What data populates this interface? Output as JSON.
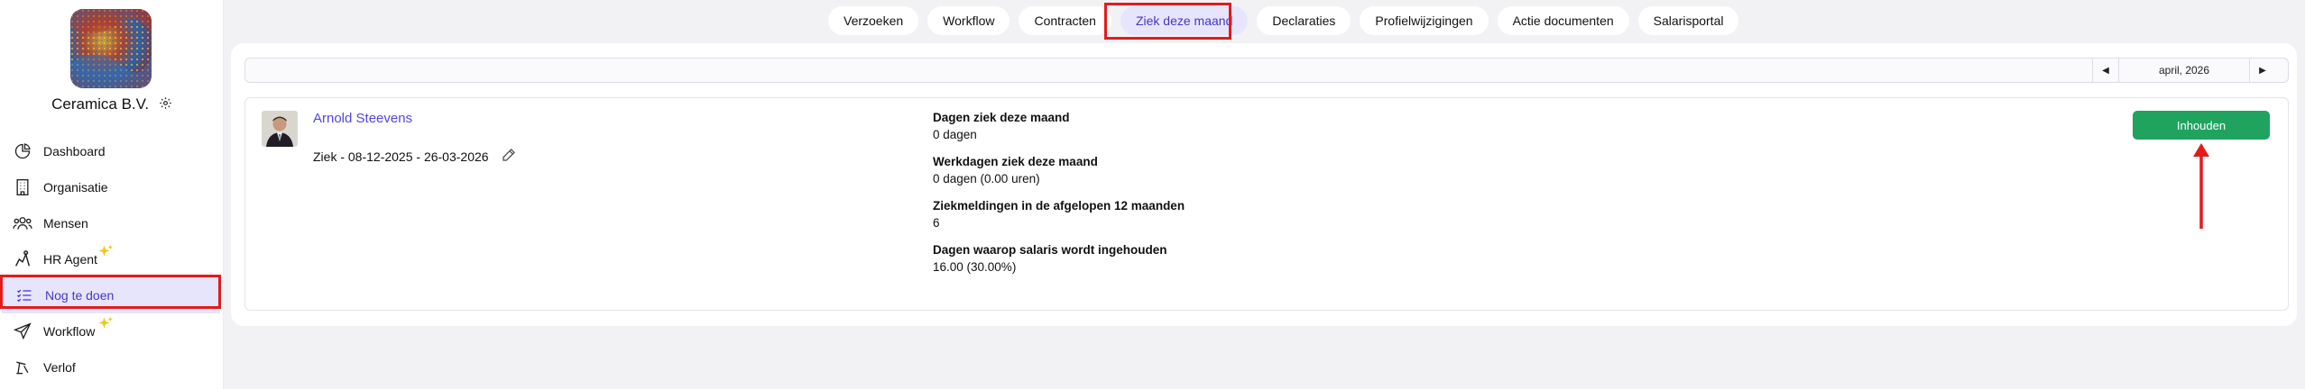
{
  "sidebar": {
    "company_name": "Ceramica B.V.",
    "items": [
      {
        "label": "Dashboard",
        "icon": "dashboard-icon"
      },
      {
        "label": "Organisatie",
        "icon": "building-icon"
      },
      {
        "label": "Mensen",
        "icon": "people-icon"
      },
      {
        "label": "HR Agent",
        "icon": "agent-icon",
        "badge": "sparkle-icon"
      },
      {
        "label": "Nog te doen",
        "icon": "checklist-icon",
        "active": true
      },
      {
        "label": "Workflow",
        "icon": "send-icon",
        "badge": "sparkle-icon"
      },
      {
        "label": "Verlof",
        "icon": "umbrella-icon"
      }
    ]
  },
  "tabs": [
    {
      "label": "Verzoeken"
    },
    {
      "label": "Workflow"
    },
    {
      "label": "Contracten"
    },
    {
      "label": "Ziek deze maand",
      "active": true
    },
    {
      "label": "Declaraties"
    },
    {
      "label": "Profielwijzigingen"
    },
    {
      "label": "Actie documenten"
    },
    {
      "label": "Salarisportal"
    }
  ],
  "date_filter": {
    "current": "april, 2026",
    "prev_icon": "chevron-left-icon",
    "next_icon": "chevron-right-icon"
  },
  "record": {
    "name": "Arnold Steevens",
    "sick_period": "Ziek - 08-12-2025 - 26-03-2026",
    "stats": [
      {
        "label": "Dagen ziek deze maand",
        "value": "0 dagen"
      },
      {
        "label": "Werkdagen ziek deze maand",
        "value": "0 dagen (0.00 uren)"
      },
      {
        "label": "Ziekmeldingen in de afgelopen 12 maanden",
        "value": "6"
      },
      {
        "label": "Dagen waarop salaris wordt ingehouden",
        "value": "16.00 (30.00%)"
      }
    ],
    "action_label": "Inhouden"
  },
  "colors": {
    "accent": "#4f46e5",
    "active_bg": "#e6e5fb",
    "button_green": "#1fa35f",
    "highlight_red": "#e31b1b",
    "sparkle_yellow": "#f5c518"
  }
}
